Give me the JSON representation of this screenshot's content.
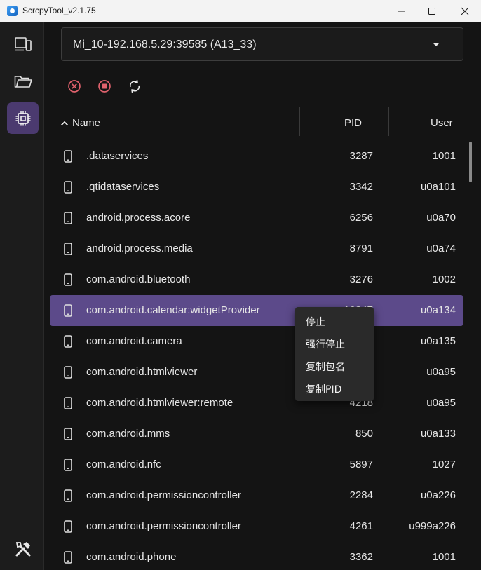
{
  "window": {
    "title": "ScrcpyTool_v2.1.75",
    "app_icon": "scrcpy-logo-icon",
    "minimize_icon": "minimize-icon",
    "maximize_icon": "maximize-icon",
    "close_icon": "close-icon"
  },
  "sidebar": {
    "items": [
      {
        "id": "devices",
        "icon": "devices-icon",
        "active": false
      },
      {
        "id": "files",
        "icon": "folder-icon",
        "active": false
      },
      {
        "id": "processes",
        "icon": "processor-icon",
        "active": true
      },
      {
        "id": "tools",
        "icon": "tools-icon",
        "active": false
      }
    ]
  },
  "device_selector": {
    "value": "Mi_10-192.168.5.29:39585 (A13_33)",
    "caret_icon": "chevron-down-icon"
  },
  "toolbar": {
    "kill_icon": "kill-process-icon",
    "stop_icon": "stop-icon",
    "refresh_icon": "refresh-icon",
    "accent_color": "#e0626d"
  },
  "table": {
    "columns": {
      "name": "Name",
      "pid": "PID",
      "user": "User"
    },
    "sort_icon": "chevron-up-icon",
    "rows": [
      {
        "name": ".dataservices",
        "pid": "3287",
        "user": "1001"
      },
      {
        "name": ".qtidataservices",
        "pid": "3342",
        "user": "u0a101"
      },
      {
        "name": "android.process.acore",
        "pid": "6256",
        "user": "u0a70"
      },
      {
        "name": "android.process.media",
        "pid": "8791",
        "user": "u0a74"
      },
      {
        "name": "com.android.bluetooth",
        "pid": "3276",
        "user": "1002"
      },
      {
        "name": "com.android.calendar:widgetProvider",
        "pid": "10347",
        "user": "u0a134",
        "selected": true
      },
      {
        "name": "com.android.camera",
        "pid": "",
        "user": "u0a135"
      },
      {
        "name": "com.android.htmlviewer",
        "pid": "",
        "user": "u0a95"
      },
      {
        "name": "com.android.htmlviewer:remote",
        "pid": "4218",
        "user": "u0a95"
      },
      {
        "name": "com.android.mms",
        "pid": "850",
        "user": "u0a133"
      },
      {
        "name": "com.android.nfc",
        "pid": "5897",
        "user": "1027"
      },
      {
        "name": "com.android.permissioncontroller",
        "pid": "2284",
        "user": "u0a226"
      },
      {
        "name": "com.android.permissioncontroller",
        "pid": "4261",
        "user": "u999a226"
      },
      {
        "name": "com.android.phone",
        "pid": "3362",
        "user": "1001"
      }
    ]
  },
  "context_menu": {
    "items": [
      "停止",
      "强行停止",
      "复制包名",
      "复制PID"
    ]
  },
  "colors": {
    "selected_row": "#5c4a8a",
    "active_nav": "#4b3a6f",
    "background": "#141414"
  }
}
